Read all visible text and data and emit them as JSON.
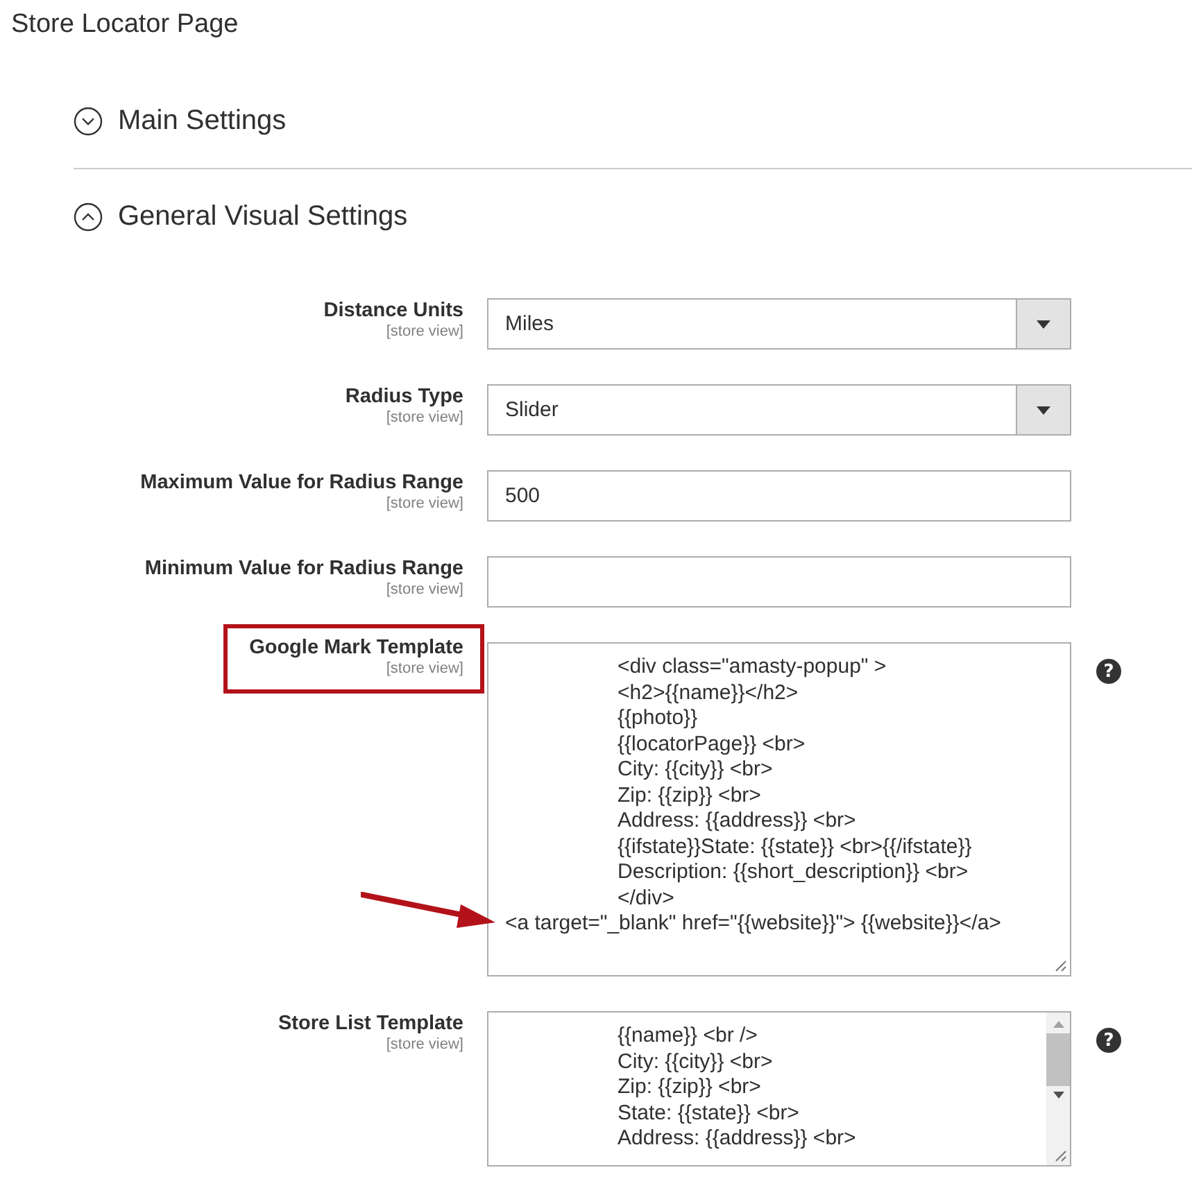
{
  "page": {
    "title": "Store Locator Page"
  },
  "sections": [
    {
      "title": "Main Settings",
      "expanded": false
    },
    {
      "title": "General Visual Settings",
      "expanded": true,
      "fields": [
        {
          "kind": "select",
          "label": "Distance Units",
          "scope": "[store view]",
          "value": "Miles"
        },
        {
          "kind": "select",
          "label": "Radius Type",
          "scope": "[store view]",
          "value": "Slider"
        },
        {
          "kind": "text",
          "label": "Maximum Value for Radius Range",
          "scope": "[store view]",
          "value": "500"
        },
        {
          "kind": "text",
          "label": "Minimum Value for Radius Range",
          "scope": "[store view]"
        },
        {
          "kind": "textarea",
          "label": "Google Mark Template",
          "scope": "[store view]",
          "highlighted": true,
          "arrow_marked": true,
          "help": "?",
          "scrollbar": false,
          "lines": [
            {
              "text": "<div class=\"amasty-popup\" >",
              "indented": true
            },
            {
              "text": "<h2>{{name}}</h2>",
              "indented": true
            },
            {
              "text": "{{photo}}",
              "indented": true
            },
            {
              "text": "{{locatorPage}} <br>",
              "indented": true
            },
            {
              "text": "City: {{city}} <br>",
              "indented": true
            },
            {
              "text": "Zip: {{zip}} <br>",
              "indented": true
            },
            {
              "text": "Address: {{address}} <br>",
              "indented": true
            },
            {
              "text": "{{ifstate}}State: {{state}} <br>{{/ifstate}}",
              "indented": true
            },
            {
              "text": "Description: {{short_description}} <br>",
              "indented": true
            },
            {
              "text": "</div>",
              "indented": true
            },
            {
              "text": "<a target=\"_blank\" href=\"{{website}}\"> {{website}}</a>",
              "indented": false
            }
          ]
        },
        {
          "kind": "textarea",
          "label": "Store List Template",
          "scope": "[store view]",
          "highlighted": false,
          "arrow_marked": false,
          "help": "?",
          "scrollbar": true,
          "lines": [
            {
              "text": "{{name}} <br />",
              "indented": true
            },
            {
              "text": "City: {{city}} <br>",
              "indented": true
            },
            {
              "text": "Zip: {{zip}} <br>",
              "indented": true
            },
            {
              "text": "State: {{state}} <br>",
              "indented": true
            },
            {
              "text": "Address: {{address}} <br>",
              "indented": true
            }
          ]
        }
      ]
    }
  ]
}
